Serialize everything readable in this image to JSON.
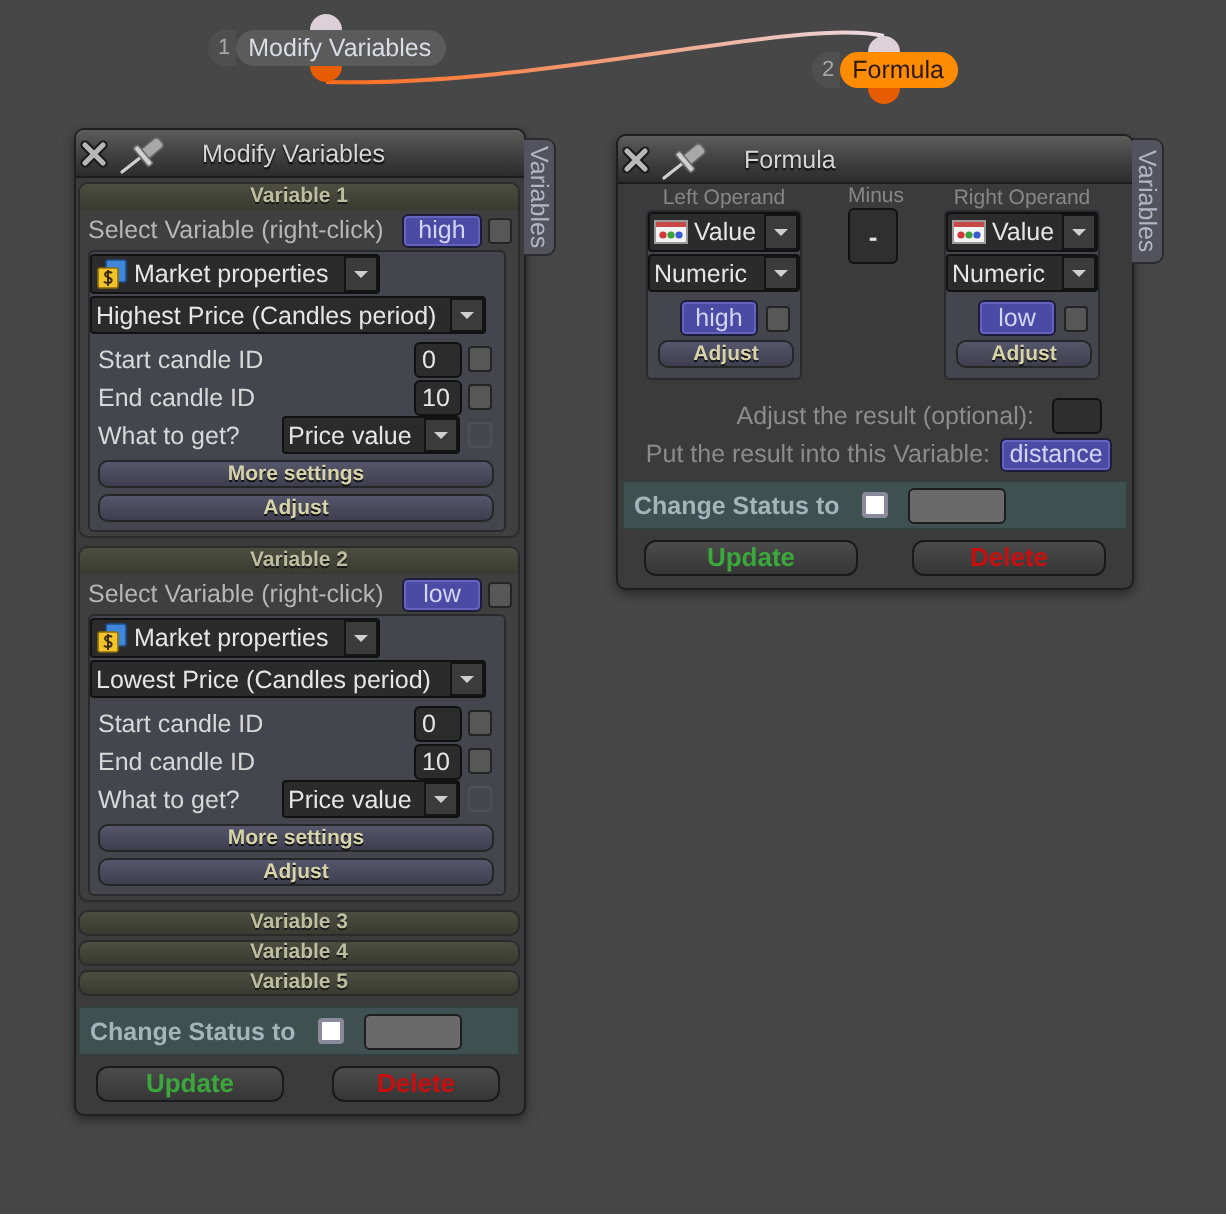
{
  "nodes": [
    {
      "number": "1",
      "label": "Modify Variables",
      "selected": false
    },
    {
      "number": "2",
      "label": "Formula",
      "selected": true
    }
  ],
  "modify_variables_window": {
    "title": "Modify Variables",
    "side_tab": "Variables",
    "variables": [
      {
        "title": "Variable 1",
        "expanded": true,
        "select_label": "Select Variable (right-click)",
        "variable": "high",
        "checked": false,
        "source": "Market properties",
        "property": "Highest Price (Candles period)",
        "fields": [
          {
            "kind": "number",
            "label": "Start candle ID",
            "value": "0",
            "checked": false,
            "disabled": false
          },
          {
            "kind": "number",
            "label": "End candle ID",
            "value": "10",
            "checked": false,
            "disabled": false
          },
          {
            "kind": "dropdown",
            "label": "What to get?",
            "value": "Price value",
            "checked": false,
            "disabled": true
          }
        ],
        "buttons": [
          "More settings",
          "Adjust"
        ]
      },
      {
        "title": "Variable 2",
        "expanded": true,
        "select_label": "Select Variable (right-click)",
        "variable": "low",
        "checked": false,
        "source": "Market properties",
        "property": "Lowest Price (Candles period)",
        "fields": [
          {
            "kind": "number",
            "label": "Start candle ID",
            "value": "0",
            "checked": false,
            "disabled": false
          },
          {
            "kind": "number",
            "label": "End candle ID",
            "value": "10",
            "checked": false,
            "disabled": false
          },
          {
            "kind": "dropdown",
            "label": "What to get?",
            "value": "Price value",
            "checked": false,
            "disabled": true
          }
        ],
        "buttons": [
          "More settings",
          "Adjust"
        ]
      },
      {
        "title": "Variable 3",
        "expanded": false
      },
      {
        "title": "Variable 4",
        "expanded": false
      },
      {
        "title": "Variable 5",
        "expanded": false
      }
    ],
    "change_status": {
      "label": "Change Status to",
      "checked": false
    },
    "buttons": [
      {
        "label": "Update",
        "kind": "update"
      },
      {
        "label": "Delete",
        "kind": "delete"
      }
    ]
  },
  "formula_window": {
    "title": "Formula",
    "side_tab": "Variables",
    "columns": [
      {
        "kind": "operand",
        "heading": "Left Operand",
        "source": "Value",
        "format": "Numeric",
        "variable": "high",
        "checked": false,
        "button": "Adjust"
      },
      {
        "kind": "operator",
        "heading": "Minus",
        "symbol": "-"
      },
      {
        "kind": "operand",
        "heading": "Right Operand",
        "source": "Value",
        "format": "Numeric",
        "variable": "low",
        "checked": false,
        "button": "Adjust"
      }
    ],
    "adjust_result_label": "Adjust the result (optional):",
    "result": {
      "label": "Put the result into this Variable:",
      "variable": "distance"
    },
    "change_status": {
      "label": "Change Status to",
      "checked": false
    },
    "buttons": [
      {
        "label": "Update",
        "kind": "update"
      },
      {
        "label": "Delete",
        "kind": "delete"
      }
    ]
  }
}
